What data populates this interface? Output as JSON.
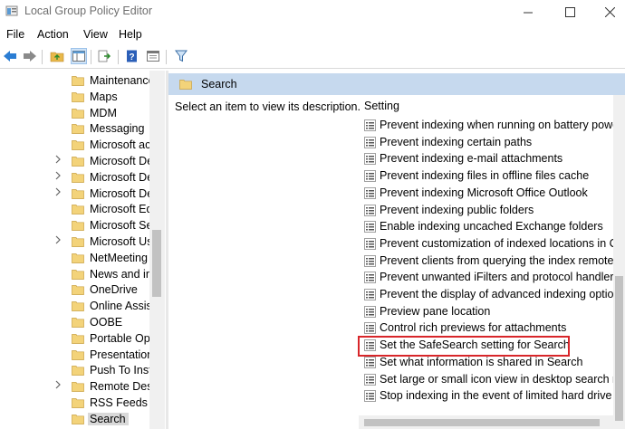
{
  "window": {
    "title": "Local Group Policy Editor",
    "minimize_icon": "minimize-icon",
    "maximize_icon": "maximize-icon",
    "close_icon": "close-icon"
  },
  "menu": {
    "file": "File",
    "action": "Action",
    "view": "View",
    "help": "Help"
  },
  "toolbar": {
    "icons": [
      "back-arrow-icon",
      "forward-arrow-icon",
      "up-folder-icon",
      "show-hide-tree-icon",
      "export-list-icon",
      "help-icon",
      "properties-icon",
      "filter-icon"
    ]
  },
  "tree": {
    "items": [
      {
        "label": "Maintenance",
        "expandable": false
      },
      {
        "label": "Maps",
        "expandable": false
      },
      {
        "label": "MDM",
        "expandable": false
      },
      {
        "label": "Messaging",
        "expandable": false
      },
      {
        "label": "Microsoft ac",
        "expandable": false
      },
      {
        "label": "Microsoft De",
        "expandable": true
      },
      {
        "label": "Microsoft De",
        "expandable": true
      },
      {
        "label": "Microsoft De",
        "expandable": true
      },
      {
        "label": "Microsoft Ed",
        "expandable": false
      },
      {
        "label": "Microsoft Se",
        "expandable": false
      },
      {
        "label": "Microsoft Us",
        "expandable": true
      },
      {
        "label": "NetMeeting",
        "expandable": false
      },
      {
        "label": "News and int",
        "expandable": false
      },
      {
        "label": "OneDrive",
        "expandable": false
      },
      {
        "label": "Online Assist",
        "expandable": false
      },
      {
        "label": "OOBE",
        "expandable": false
      },
      {
        "label": "Portable Ope",
        "expandable": false
      },
      {
        "label": "Presentation",
        "expandable": false
      },
      {
        "label": "Push To Insta",
        "expandable": false
      },
      {
        "label": "Remote Desk",
        "expandable": true
      },
      {
        "label": "RSS Feeds",
        "expandable": false
      },
      {
        "label": "Search",
        "expandable": false,
        "selected": true
      }
    ]
  },
  "right_pane": {
    "header": "Search",
    "description": "Select an item to view its description.",
    "column_header": "Setting",
    "settings": [
      "Prevent indexing when running on battery power t",
      "Prevent indexing certain paths",
      "Prevent indexing e-mail attachments",
      "Prevent indexing files in offline files cache",
      "Prevent indexing Microsoft Office Outlook",
      "Prevent indexing public folders",
      "Enable indexing uncached Exchange folders",
      "Prevent customization of indexed locations in Cor",
      "Prevent clients from querying the index remotely",
      "Prevent unwanted iFilters and protocol handlers",
      "Prevent the display of advanced indexing options",
      "Preview pane location",
      "Control rich previews for attachments",
      "Set the SafeSearch setting for Search",
      "Set what information is shared in Search",
      "Set large or small icon view in desktop search resu",
      "Stop indexing in the event of limited hard drive sp"
    ],
    "highlighted": "Set the SafeSearch setting for Search"
  },
  "colors": {
    "header_bg": "#c6d9ee",
    "highlight_border": "#d8262a",
    "folder": "#e8b84a"
  }
}
